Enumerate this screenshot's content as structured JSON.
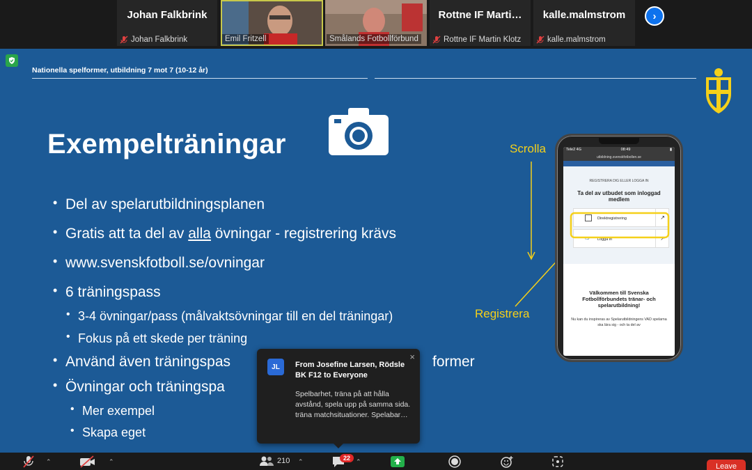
{
  "participants": {
    "tiles": [
      {
        "display": "Johan Falkbrink",
        "caption": "Johan Falkbrink",
        "muted": true,
        "video": false
      },
      {
        "display": "",
        "caption": "Emil Fritzell",
        "muted": false,
        "video": true,
        "active": true
      },
      {
        "display": "",
        "caption": "Smålands Fotbollförbund",
        "muted": false,
        "video": true
      },
      {
        "display": "Rottne IF Marti…",
        "caption": "Rottne IF Martin Klotz",
        "muted": true,
        "video": false
      },
      {
        "display": "kalle.malmstrom",
        "caption": "kalle.malmstrom",
        "muted": true,
        "video": false
      }
    ],
    "next_icon": "chevron-right-icon"
  },
  "slide": {
    "header": "Nationella spelformer, utbildning 7 mot 7 (10-12 år)",
    "title": "Exempelträningar",
    "bullets": {
      "b1": "Del av spelarutbildningsplanen",
      "b2_pre": "Gratis att ta del av ",
      "b2_u": "alla",
      "b2_post": " övningar - registrering krävs",
      "b3": "www.svenskfotboll.se/ovningar",
      "b4": "6 träningspass",
      "b4a": "3-4 övningar/pass (målvaktsövningar till en del träningar)",
      "b4b": "Fokus på ett skede per träning",
      "b5_pre": " Använd även träningspas",
      "b5_post": "former",
      "b6": " Övningar och träningspa",
      "b6a": "Mer exempel",
      "b6b": "Skapa eget"
    },
    "scroll_label": "Scrolla",
    "register_label": "Registrera",
    "accent_yellow": "#f5d01a",
    "background": "#1c5a96"
  },
  "phone": {
    "carrier": "Tele2  4G",
    "time": "08:49",
    "url": "utbildning.svenskfotbollen.se",
    "register_or_login": "REGISTRERA DIG ELLER LOGGA IN",
    "heading": "Ta del av utbudet som inloggad medlem",
    "direct_reg": "Direktregistrering",
    "login": "Logga in",
    "welcome": "Välkommen till Svenska Fotbollförbundets tränar- och spelarutbildning!",
    "body": "Nu kan du inspireras av Spelarutbildningens VAD spelarna ska lära sig - och ta del av"
  },
  "chat": {
    "avatar": "JL",
    "from": "From Josefine Larsen, Rödsle BK F12 to Everyone",
    "message": "Spelbarhet, träna på att hålla avstånd, spela upp på samma sida. träna matchsituationer. Spelabar…"
  },
  "toolbar": {
    "participants_count": "210",
    "chat_badge": "22",
    "leave": "Leave"
  }
}
